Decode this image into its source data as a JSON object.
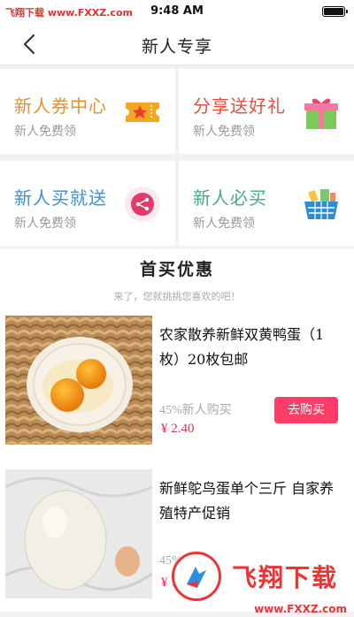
{
  "status": {
    "carrier": "飞翔下载 www.FXXZ.com",
    "time": "9:48 AM"
  },
  "nav": {
    "title": "新人专享"
  },
  "cards": [
    {
      "title": "新人券中心",
      "sub": "新人免费领",
      "color": "#e9902d",
      "icon": "ticket-icon"
    },
    {
      "title": "分享送好礼",
      "sub": "新人免费领",
      "color": "#e2503f",
      "icon": "gift-icon"
    },
    {
      "title": "新人买就送",
      "sub": "新人免费领",
      "color": "#3b8fd6",
      "icon": "share-icon"
    },
    {
      "title": "新人必买",
      "sub": "新人免费领",
      "color": "#3fb07a",
      "icon": "basket-icon"
    }
  ],
  "section": {
    "title": "首买优惠",
    "subtitle": "来了，您就挑挑您喜欢的吧！"
  },
  "products": [
    {
      "name": "农家散养新鲜双黄鸭蛋（1枚）20枚包邮",
      "meta": "45%新人购买",
      "price": "¥ 2.40",
      "button": "去购买"
    },
    {
      "name": "新鲜鸵鸟蛋单个三斤 自家养殖特产促销",
      "meta": "45%",
      "price": "¥ 1",
      "button": ""
    }
  ],
  "watermark": {
    "text": "飞翔下载",
    "url": "www.FXXZ.com"
  },
  "colors": {
    "accent": "#ff3e67",
    "price": "#e0324f"
  }
}
